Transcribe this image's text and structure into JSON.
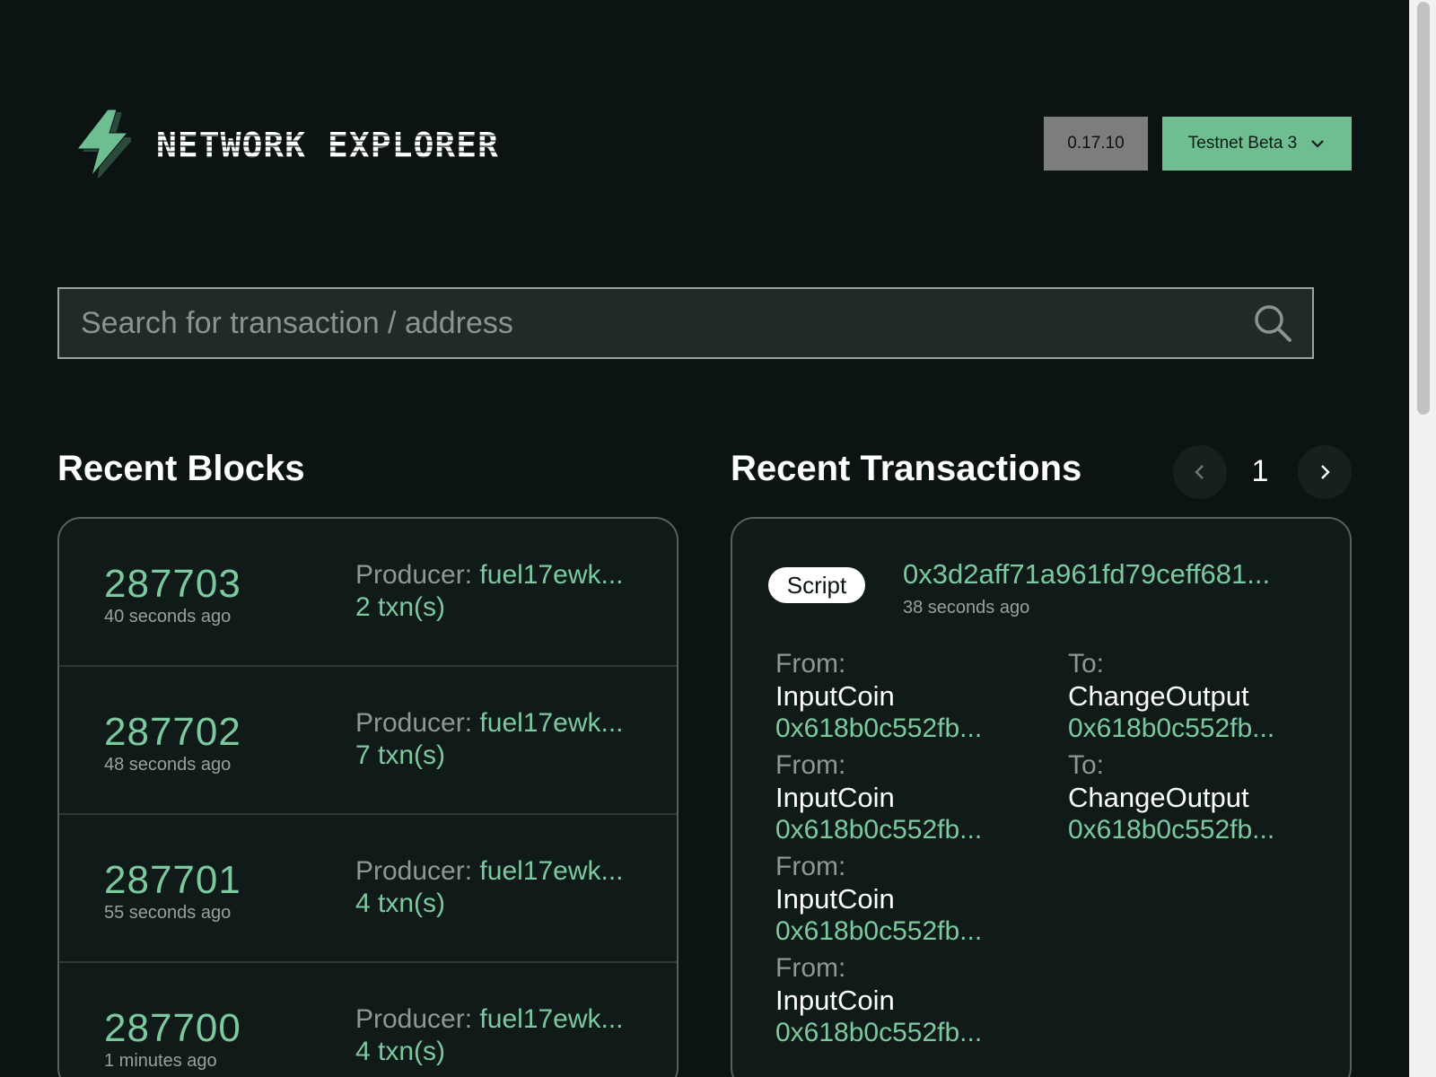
{
  "header": {
    "brand": "NETWORK EXPLORER",
    "version": "0.17.10",
    "network": "Testnet Beta 3"
  },
  "search": {
    "placeholder": "Search for transaction / address"
  },
  "blocks": {
    "title": "Recent Blocks",
    "producer_label": "Producer:",
    "items": [
      {
        "number": "287703",
        "time": "40 seconds ago",
        "producer": "fuel17ewk...",
        "txns": "2 txn(s)"
      },
      {
        "number": "287702",
        "time": "48 seconds ago",
        "producer": "fuel17ewk...",
        "txns": "7 txn(s)"
      },
      {
        "number": "287701",
        "time": "55 seconds ago",
        "producer": "fuel17ewk...",
        "txns": "4 txn(s)"
      },
      {
        "number": "287700",
        "time": "1 minutes ago",
        "producer": "fuel17ewk...",
        "txns": "4 txn(s)"
      }
    ]
  },
  "transactions": {
    "title": "Recent Transactions",
    "page": "1",
    "items": [
      {
        "type": "Script",
        "hash": "0x3d2aff71a961fd79ceff681...",
        "time": "38 seconds ago",
        "from": [
          {
            "label": "From:",
            "kind": "InputCoin",
            "address": "0x618b0c552fb..."
          },
          {
            "label": "From:",
            "kind": "InputCoin",
            "address": "0x618b0c552fb..."
          },
          {
            "label": "From:",
            "kind": "InputCoin",
            "address": "0x618b0c552fb..."
          },
          {
            "label": "From:",
            "kind": "InputCoin",
            "address": "0x618b0c552fb..."
          }
        ],
        "to": [
          {
            "label": "To:",
            "kind": "ChangeOutput",
            "address": "0x618b0c552fb..."
          },
          {
            "label": "To:",
            "kind": "ChangeOutput",
            "address": "0x618b0c552fb..."
          }
        ]
      }
    ]
  },
  "colors": {
    "background": "#0b1413",
    "accent": "#7cc9a0",
    "network_button": "#6fbe92",
    "version_badge": "#7b7e7d"
  },
  "icons": {
    "logo": "lightning-bolt-icon",
    "search": "search-icon",
    "dropdown": "chevron-down-icon",
    "prev": "chevron-left-icon",
    "next": "chevron-right-icon"
  }
}
